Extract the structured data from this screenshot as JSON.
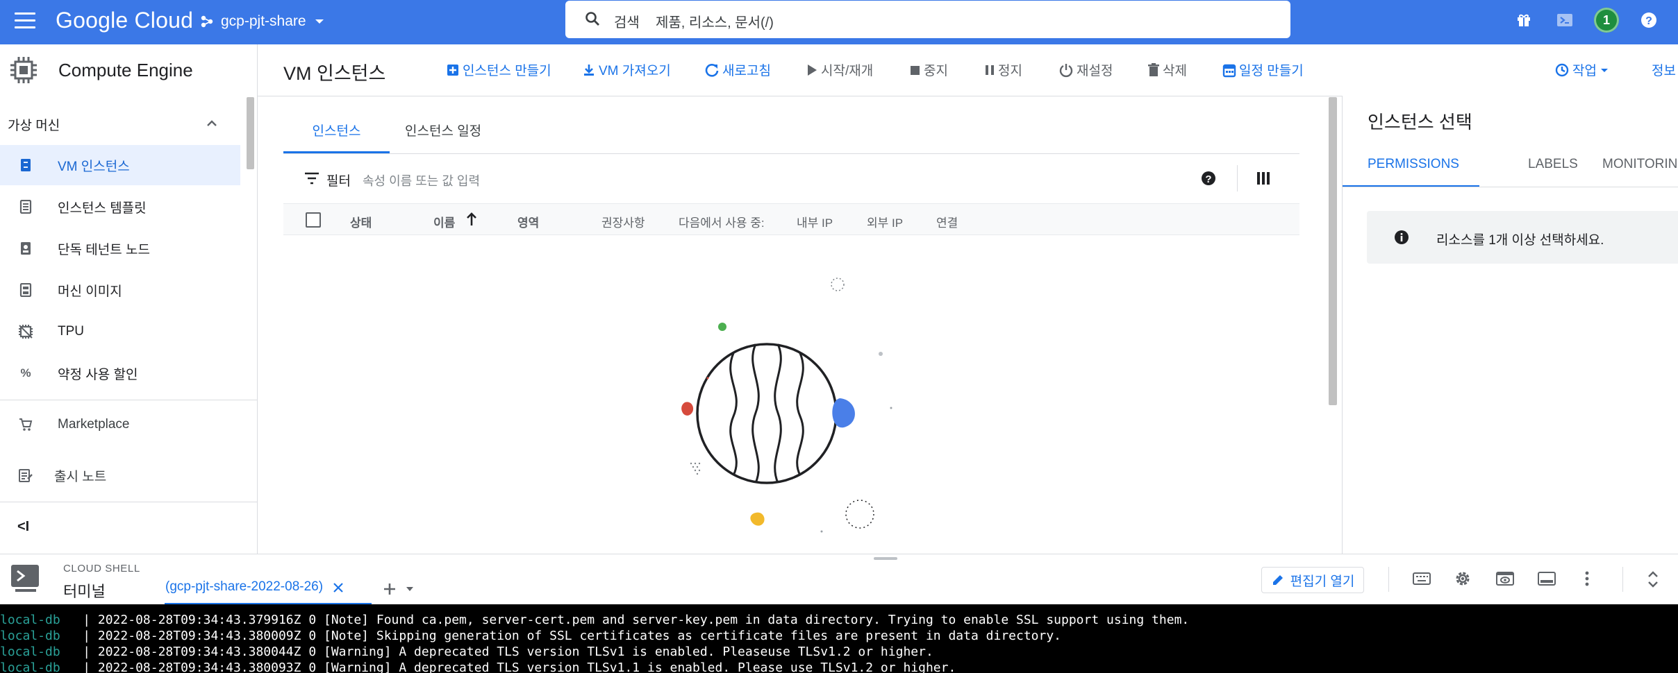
{
  "topbar": {
    "brand_google": "Google",
    "brand_cloud": "Cloud",
    "project": "gcp-pjt-share",
    "search_label": "검색",
    "search_hint": "제품, 리소스, 문서(/)",
    "notification_count": "1"
  },
  "header": {
    "product": "Compute Engine",
    "page_title": "VM 인스턴스",
    "actions": {
      "create": "인스턴스 만들기",
      "import": "VM 가져오기",
      "refresh": "새로고침",
      "start": "시작/재개",
      "stop": "중지",
      "suspend": "정지",
      "reset": "재설정",
      "delete": "삭제",
      "schedule": "일정 만들기",
      "operations": "작업",
      "info": "정보"
    }
  },
  "sidebar": {
    "section": "가상 머신",
    "items": [
      {
        "label": "VM 인스턴스",
        "icon": "vm-instance-icon"
      },
      {
        "label": "인스턴스 템플릿",
        "icon": "template-icon"
      },
      {
        "label": "단독 테넌트 노드",
        "icon": "sole-tenant-icon"
      },
      {
        "label": "머신 이미지",
        "icon": "machine-image-icon"
      },
      {
        "label": "TPU",
        "icon": "tpu-icon"
      },
      {
        "label": "약정 사용 할인",
        "icon": "percent-icon"
      }
    ],
    "marketplace": "Marketplace",
    "release_notes": "출시 노트"
  },
  "main": {
    "tabs": [
      "인스턴스",
      "인스턴스 일정"
    ],
    "filter_label": "필터",
    "filter_placeholder": "속성 이름 또는 값 입력",
    "columns": [
      "상태",
      "이름",
      "영역",
      "권장사항",
      "다음에서 사용 중:",
      "내부 IP",
      "외부 IP",
      "연결"
    ]
  },
  "right_panel": {
    "title": "인스턴스 선택",
    "tabs": [
      "PERMISSIONS",
      "LABELS",
      "MONITORING"
    ],
    "info_message": "리소스를 1개 이상 선택하세요."
  },
  "cloud_shell": {
    "caption": "CLOUD SHELL",
    "title": "터미널",
    "session_tab": "(gcp-pjt-share-2022-08-26)",
    "open_editor": "편집기 열기",
    "terminal_lines": [
      {
        "host": "local-db",
        "text": "   | 2022-08-28T09:34:43.379916Z 0 [Note] Found ca.pem, server-cert.pem and server-key.pem in data directory. Trying to enable SSL support using them."
      },
      {
        "host": "local-db",
        "text": "   | 2022-08-28T09:34:43.380009Z 0 [Note] Skipping generation of SSL certificates as certificate files are present in data directory."
      },
      {
        "host": "local-db",
        "text": "   | 2022-08-28T09:34:43.380044Z 0 [Warning] A deprecated TLS version TLSv1 is enabled. Pleaseuse TLSv1.2 or higher."
      },
      {
        "host": "local-db",
        "text": "   | 2022-08-28T09:34:43.380093Z 0 [Warning] A deprecated TLS version TLSv1.1 is enabled. Please use TLSv1.2 or higher."
      }
    ]
  },
  "colors": {
    "topbar": "#3b78e7",
    "accent": "#1a73e8",
    "active_bg": "#e8f0fe",
    "terminal_bg": "#000000",
    "terminal_host": "#2aa198"
  }
}
